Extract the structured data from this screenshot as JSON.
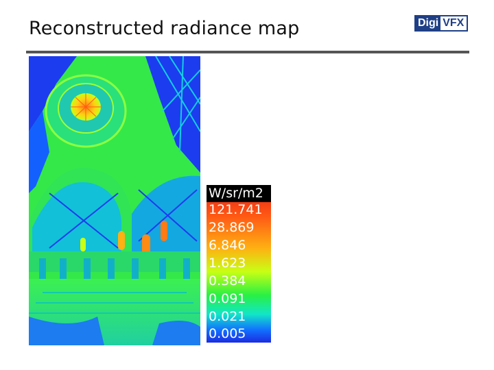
{
  "slide": {
    "title": "Reconstructed radiance map"
  },
  "logo": {
    "part1": "Digi",
    "part2": "VFX",
    "colors": {
      "dark": "#1f3f86",
      "light": "#ffffff"
    }
  },
  "radiance_image": {
    "description_icon": "false-color-radiance-map",
    "colormap": [
      "#1c2ce0",
      "#1270ff",
      "#12e6c8",
      "#28f044",
      "#c8ff14",
      "#ffb012",
      "#ff5a14",
      "#e51c14"
    ]
  },
  "legend": {
    "unit": "W/sr/m2",
    "values": [
      "121.741",
      "28.869",
      "6.846",
      "1.623",
      "0.384",
      "0.091",
      "0.021",
      "0.005"
    ]
  }
}
